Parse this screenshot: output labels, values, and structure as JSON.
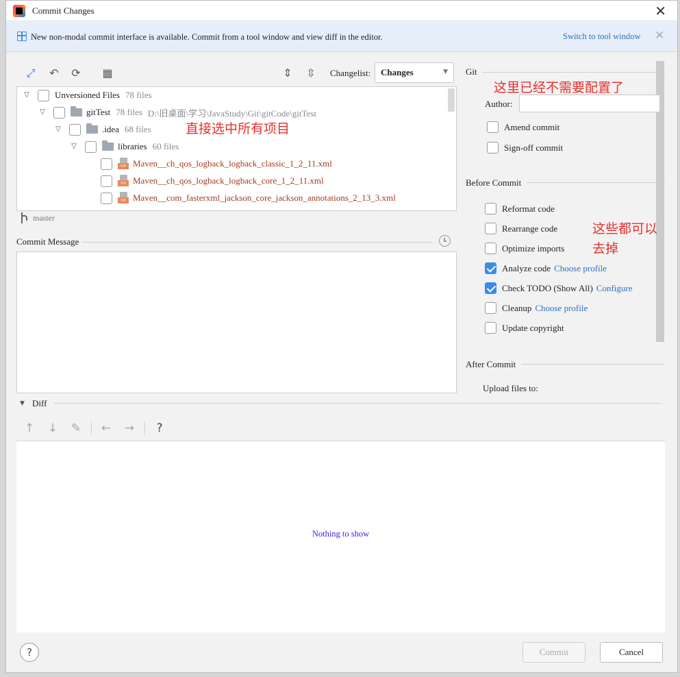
{
  "window": {
    "title": "Commit Changes"
  },
  "banner": {
    "text": "New non-modal commit interface is available. Commit from a tool window and view diff in the editor.",
    "link": "Switch to tool window"
  },
  "toolbar": {
    "changelist_label": "Changelist:",
    "changelist_value": "Changes",
    "icons": [
      "move-changes-icon",
      "undo-icon",
      "refresh-icon",
      "group-by-icon",
      "expand-all-icon",
      "collapse-all-icon"
    ]
  },
  "tree": {
    "root": {
      "label": "Unversioned Files",
      "count": "78 files"
    },
    "project": {
      "label": "gitTest",
      "count": "78 files",
      "path": "D:\\旧桌面\\学习\\JavaStudy\\Git\\gitCode\\gitTest"
    },
    "idea": {
      "label": ".idea",
      "count": "68 files"
    },
    "libraries": {
      "label": "libraries",
      "count": "60 files"
    },
    "files": [
      "Maven__ch_qos_logback_logback_classic_1_2_11.xml",
      "Maven__ch_qos_logback_logback_core_1_2_11.xml",
      "Maven__com_fasterxml_jackson_core_jackson_annotations_2_13_3.xml"
    ]
  },
  "branch": "master",
  "commit_message": {
    "label": "Commit Message",
    "value": ""
  },
  "git": {
    "section": "Git",
    "author_label": "Author:",
    "author_value": "",
    "amend": "Amend commit",
    "signoff": "Sign-off commit"
  },
  "before_commit": {
    "section": "Before Commit",
    "options": [
      {
        "label": "Reformat code",
        "checked": false,
        "link": ""
      },
      {
        "label": "Rearrange code",
        "checked": false,
        "link": ""
      },
      {
        "label": "Optimize imports",
        "checked": false,
        "link": ""
      },
      {
        "label": "Analyze code",
        "checked": true,
        "link": "Choose profile"
      },
      {
        "label": "Check TODO (Show All)",
        "checked": true,
        "link": "Configure"
      },
      {
        "label": "Cleanup",
        "checked": false,
        "link": "Choose profile"
      },
      {
        "label": "Update copyright",
        "checked": false,
        "link": ""
      }
    ]
  },
  "after_commit": {
    "section": "After Commit",
    "upload_label": "Upload files to:"
  },
  "diff": {
    "label": "Diff",
    "empty_text": "Nothing to show"
  },
  "buttons": {
    "help": "?",
    "commit": "Commit",
    "cancel": "Cancel"
  },
  "annotations": {
    "git_note": "这里已经不需要配置了",
    "tree_note": "直接选中所有项目",
    "options_note_1": "这些都可以",
    "options_note_2": "去掉"
  },
  "colors": {
    "accent": "#3c8ce7",
    "link": "#2d6fc1",
    "annotation": "#e8302c",
    "file_text": "#a23c1e"
  }
}
